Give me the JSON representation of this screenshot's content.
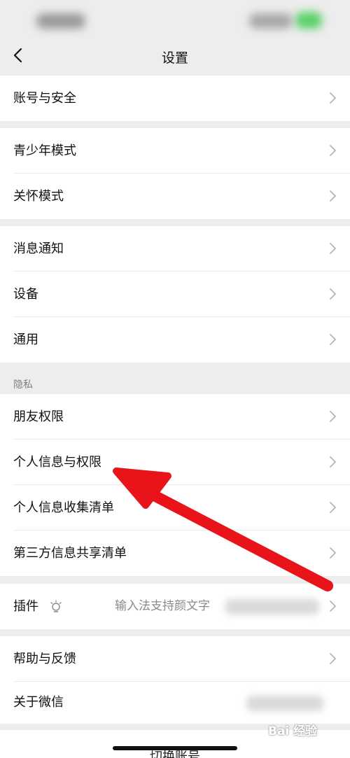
{
  "nav": {
    "title": "设置"
  },
  "groups": [
    {
      "items": [
        {
          "label": "账号与安全"
        }
      ]
    },
    {
      "items": [
        {
          "label": "青少年模式"
        },
        {
          "label": "关怀模式"
        }
      ]
    },
    {
      "items": [
        {
          "label": "消息通知"
        },
        {
          "label": "设备"
        },
        {
          "label": "通用"
        }
      ]
    },
    {
      "header": "隐私",
      "items": [
        {
          "label": "朋友权限"
        },
        {
          "label": "个人信息与权限"
        },
        {
          "label": "个人信息收集清单"
        },
        {
          "label": "第三方信息共享清单"
        }
      ]
    },
    {
      "items": [
        {
          "label": "插件",
          "value": "输入法支持颜文字"
        }
      ]
    },
    {
      "items": [
        {
          "label": "帮助与反馈"
        },
        {
          "label": "关于微信"
        }
      ]
    }
  ],
  "bottom": {
    "label": "切换账号"
  },
  "watermark": {
    "text": "Bai 经验"
  },
  "colors": {
    "background": "#ededed",
    "arrow": "#e8141a",
    "status_green": "#5bd06a"
  }
}
